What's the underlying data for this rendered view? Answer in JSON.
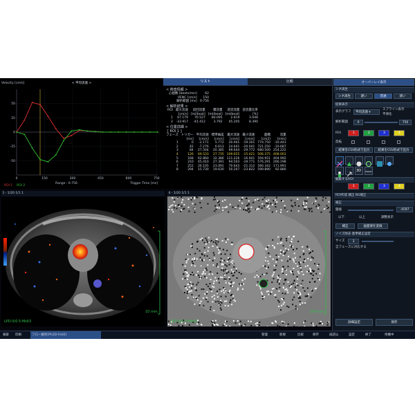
{
  "graph": {
    "title": "< 平均流速 >",
    "ylabel": "Velocity [cm/s]",
    "xlabel_range": "Range : 0-756",
    "xlabel_trigger": "Trigger Time [ms]",
    "legend": [
      "ROI 1",
      "ROI 2"
    ]
  },
  "chart_data": {
    "type": "line",
    "title": "< 平均流速 >",
    "xlabel": "Trigger Time [ms]",
    "ylabel": "Velocity [cm/s]",
    "xlim": [
      0,
      756
    ],
    "ylim": [
      -75,
      75
    ],
    "xticks": [
      0,
      150,
      300,
      450,
      600,
      750
    ],
    "yticks": [
      50,
      25,
      0,
      -25,
      -50
    ],
    "grid": true,
    "series": [
      {
        "name": "ROI 1",
        "color": "#e03030",
        "x": [
          0,
          42,
          84,
          126,
          168,
          210,
          252,
          294,
          336,
          378,
          420,
          462,
          504,
          546,
          588,
          630,
          672,
          714,
          756
        ],
        "values": [
          0,
          21,
          52,
          48,
          28,
          6,
          -11,
          -6,
          3,
          2,
          1,
          0,
          0,
          0,
          0,
          0,
          0,
          0,
          0
        ]
      },
      {
        "name": "ROI 2",
        "color": "#30c030",
        "x": [
          0,
          42,
          84,
          126,
          168,
          210,
          252,
          294,
          336,
          378,
          420,
          462,
          504,
          546,
          588,
          630,
          672,
          714,
          756
        ],
        "values": [
          0,
          -4,
          -28,
          -48,
          -52,
          -40,
          -15,
          2,
          4,
          2,
          1,
          0,
          0,
          0,
          0,
          0,
          0,
          0,
          0
        ]
      }
    ]
  },
  "tabs": [
    "リスト",
    "比較",
    "オーバーレイ表示"
  ],
  "summary": {
    "head1": "< 検査情報 >",
    "rows1": [
      [
        "心拍数 [beats/min]",
        "62"
      ],
      [
        "VENC [cm/s]",
        "150"
      ],
      [
        "解析範囲 [ms]",
        "0-756"
      ]
    ],
    "head2": "< 解析結果 >",
    "cols2": [
      "ROI",
      "最大流速",
      "前回流量",
      "積流量",
      "逆流流量",
      "逆流量比率"
    ],
    "units2": [
      "",
      "[cm/s]",
      "[ml/beat]",
      "[ml/beat]",
      "[ml/beat]",
      "[%]"
    ],
    "rows2": [
      [
        "1",
        "67.179",
        "70.527",
        "80.095",
        "2.819",
        "3.048"
      ],
      [
        "2",
        "-33.917",
        "-41.412",
        "3.792",
        "45.205",
        "8.390"
      ]
    ],
    "head3": "< 位置詳細 >",
    "roi3": "[ ROI 1 ]",
    "cols3": [
      "フェーズ",
      "トリガー",
      "平均流速",
      "標準偏差",
      "最大流速",
      "最小流速",
      "面積",
      "流量"
    ],
    "units3": [
      "",
      "[ms]",
      "[cm/s]",
      "[cm/s]",
      "[cm/s]",
      "[cm/s]",
      "[cm2]",
      "[ml/s]"
    ],
    "rows3": [
      [
        "1",
        "0",
        "-2.171",
        "5.772",
        "20.941",
        "-19.301",
        "774.750",
        "-10.443"
      ],
      [
        "2",
        "42",
        "-7.276",
        "6.613",
        "24.641",
        "-20.041",
        "721.250",
        "-10.687"
      ],
      [
        "3",
        "84",
        "27.504",
        "20.385",
        "69.644",
        "-29.772",
        "680.500",
        "254.222"
      ],
      [
        "4",
        "126",
        "69.533",
        "27.735",
        "109.655",
        "-15.421",
        "506.375",
        "408.001"
      ],
      [
        "5",
        "168",
        "62.860",
        "32.386",
        "111.226",
        "-16.941",
        "594.951",
        "404.992"
      ],
      [
        "6",
        "210",
        "45.410",
        "27.391",
        "94.503",
        "-19.771",
        "576.291",
        "266.198"
      ],
      [
        "7",
        "252",
        "26.105",
        "23.091",
        "70.643",
        "-21.312",
        "566.342",
        "171.991"
      ],
      [
        "8",
        "294",
        "15.730",
        "19.630",
        "50.207",
        "-23.822",
        "599.890",
        "92.880"
      ]
    ]
  },
  "rpanel": {
    "tab": "オーバーレイ表示",
    "sec1": "シネ再生",
    "play_btns": [
      "シネ再生",
      "遅い",
      "普通",
      "速い"
    ],
    "sec2": "結果表示",
    "graph_label": "表示グラフ",
    "graph_value": "平均流速",
    "opt1": "スプライン表示",
    "opt2": "平滑化",
    "range_label": "解析範囲",
    "range_from": "0",
    "range_to": "756",
    "roi_label": "ROI",
    "roi_colors": [
      "#d02020",
      "#20a040",
      "#2030d0",
      "#e0d020"
    ],
    "roi_nums": [
      "1",
      "2",
      "3",
      "4"
    ],
    "reverse_label": "反転",
    "btn_list": "結果をCSV形式で出力",
    "btn_csv": "結果をCSV形式で出力",
    "tool_labels": [
      "3D",
      "Vessel"
    ],
    "sec3": "編集するROI",
    "sec4": "ROI作成  補正  BG補正",
    "sec5": "補正",
    "cor_label": "閾値",
    "cor_value": "-4597",
    "ratio_opts": [
      "以下",
      "以上",
      "調整表示"
    ],
    "btn_fix": "補正",
    "btn_recalc": "画面値を変換",
    "sec6": "ノイズ除去 基準補正設定",
    "size_label": "サイズ",
    "size_value": "3",
    "all_phase": "全フェーズに対応する",
    "btn_detail": "詳細設定",
    "btn_save": "保存"
  },
  "image_left": {
    "header": "1 - 1/20 1/1 1",
    "label": "LPD:0/0.5:Ms63",
    "scale": "10 mm"
  },
  "image_right": {
    "header": "4 - 1/20 1/1 1",
    "label": "LPD:0/0.5:Ms63",
    "scale": "100 mm"
  },
  "taskbar": {
    "items": [
      "検索",
      "印刷",
      "フロー解析[Ph2D-Fe02]",
      "管理",
      "新規",
      "比較",
      "保存",
      "再読込",
      "設定",
      "終了"
    ],
    "status": "待機中"
  }
}
